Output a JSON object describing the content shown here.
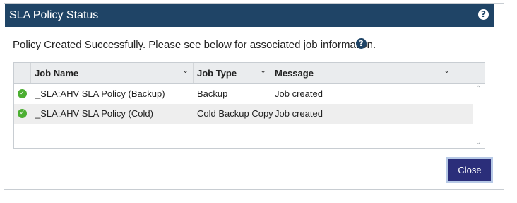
{
  "dialog": {
    "title": "SLA Policy Status",
    "help_icon": "question-circle-icon",
    "message": "Policy Created Successfully. Please see below for associated job information.",
    "info_icon": "question-circle-icon"
  },
  "table": {
    "columns": [
      {
        "label": "Job Name"
      },
      {
        "label": "Job Type"
      },
      {
        "label": "Message"
      }
    ],
    "rows": [
      {
        "status": "success",
        "job_name": "_SLA:AHV SLA Policy (Backup)",
        "job_type": "Backup",
        "message": "Job created"
      },
      {
        "status": "success",
        "job_name": "_SLA:AHV SLA Policy (Cold)",
        "job_type": "Cold Backup Copy",
        "message": "Job created"
      }
    ]
  },
  "buttons": {
    "close_label": "Close"
  },
  "colors": {
    "titlebar": "#1f4466",
    "success": "#4caf32",
    "close_button": "#2b2e7a"
  }
}
